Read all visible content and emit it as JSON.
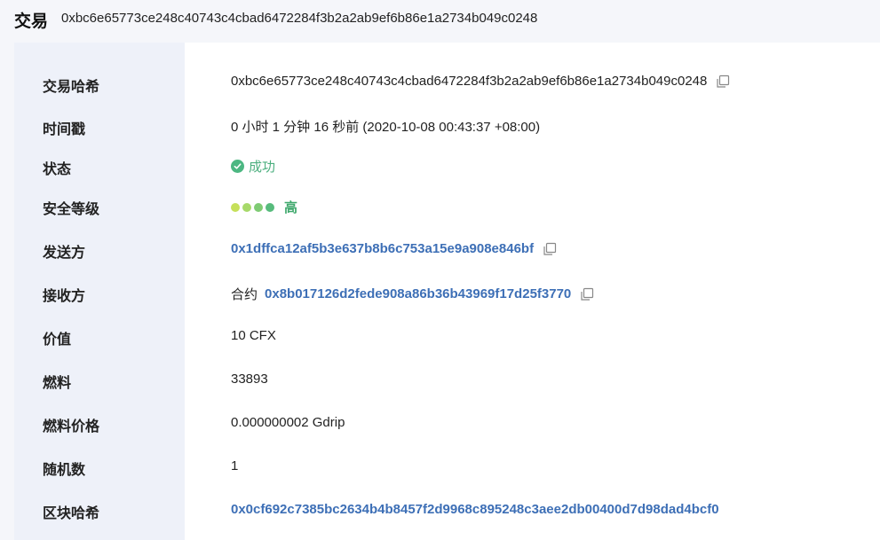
{
  "header": {
    "title": "交易",
    "hash": "0xbc6e65773ce248c40743c4cbad6472284f3b2a2ab9ef6b86e1a2734b049c0248"
  },
  "colors": {
    "link": "#3d6fb6",
    "success": "#4cb782",
    "level_dots": [
      "#c6e05a",
      "#a7d96a",
      "#7fcb74",
      "#57bb7c"
    ],
    "label_bg": "#eef1f9"
  },
  "rows": {
    "tx_hash": {
      "label": "交易哈希",
      "value": "0xbc6e65773ce248c40743c4cbad6472284f3b2a2ab9ef6b86e1a2734b049c0248",
      "icon": "copy-icon"
    },
    "timestamp": {
      "label": "时间戳",
      "value": "0 小时 1 分钟 16 秒前  (2020-10-08 00:43:37 +08:00)"
    },
    "status": {
      "label": "状态",
      "value": "成功",
      "icon": "check-circle-icon"
    },
    "security": {
      "label": "安全等级",
      "value": "高",
      "dots": 4
    },
    "from": {
      "label": "发送方",
      "value": "0x1dffca12af5b3e637b8b6c753a15e9a908e846bf",
      "icon": "copy-icon"
    },
    "to": {
      "label": "接收方",
      "prefix": "合约",
      "value": "0x8b017126d2fede908a86b36b43969f17d25f3770",
      "icon": "copy-icon"
    },
    "value": {
      "label": "价值",
      "value": "10 CFX"
    },
    "gas": {
      "label": "燃料",
      "value": "33893"
    },
    "gas_price": {
      "label": "燃料价格",
      "value": "0.000000002 Gdrip"
    },
    "nonce": {
      "label": "随机数",
      "value": "1"
    },
    "block_hash": {
      "label": "区块哈希",
      "value": "0x0cf692c7385bc2634b4b8457f2d9968c895248c3aee2db00400d7d98dad4bcf0"
    }
  }
}
